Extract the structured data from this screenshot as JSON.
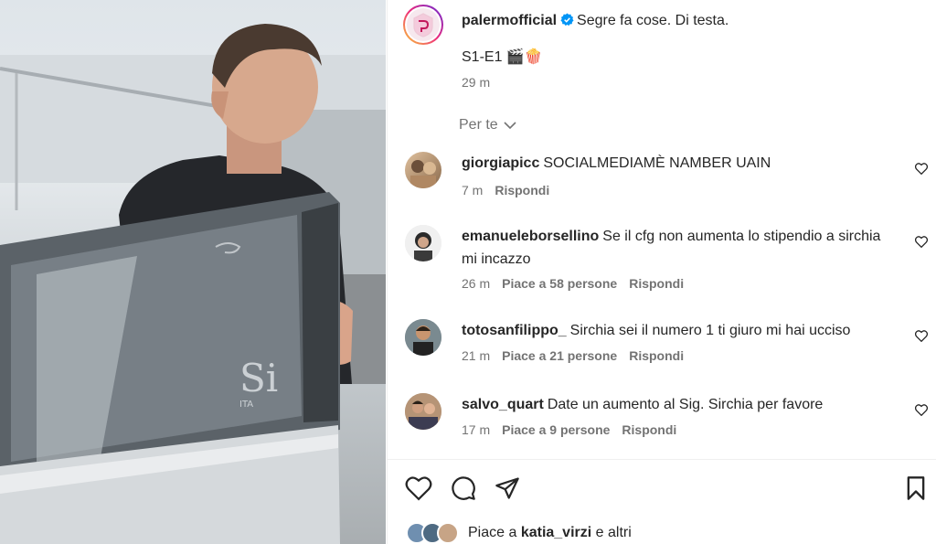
{
  "post": {
    "author": "palermofficial",
    "caption": "Segre fa cose. Di testa.",
    "caption_line2": "S1-E1 🎬🍿",
    "time": "29 m",
    "verified_icon": "verified-badge-icon",
    "brand_color": "#ee2a7b"
  },
  "filter": {
    "label": "Per te"
  },
  "comments": [
    {
      "user": "giorgiapicc",
      "text": "SOCIALMEDIAMÈ NAMBER UAIN",
      "time": "7 m",
      "likes": "",
      "reply": "Rispondi"
    },
    {
      "user": "emanueleborsellino",
      "text": "Se il cfg non aumenta lo stipendio a sirchia mi incazzo",
      "time": "26 m",
      "likes": "Piace a 58 persone",
      "reply": "Rispondi"
    },
    {
      "user": "totosanfilippo_",
      "text": "Sirchia sei il numero 1 ti giuro mi hai ucciso",
      "time": "21 m",
      "likes": "Piace a 21 persone",
      "reply": "Rispondi"
    },
    {
      "user": "salvo_quart",
      "text": "Date un aumento al Sig. Sirchia per favore",
      "time": "17 m",
      "likes": "Piace a 9 persone",
      "reply": "Rispondi"
    }
  ],
  "likes_summary": {
    "prefix": "Piace a ",
    "user": "katia_virzi",
    "suffix": " e altri"
  },
  "media": {
    "watermark": "Si",
    "watermark_sub": "ITA"
  }
}
